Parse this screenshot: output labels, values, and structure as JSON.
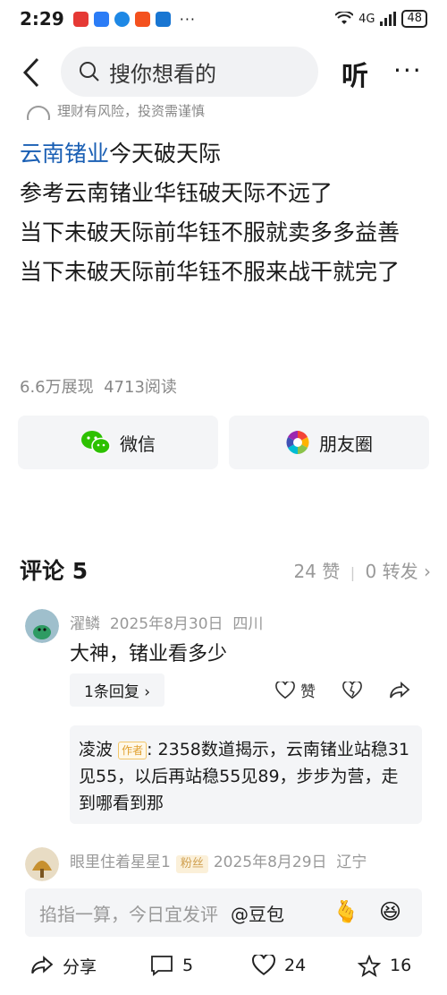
{
  "status": {
    "time": "2:29",
    "dots": "···",
    "network": "4G",
    "battery": "48"
  },
  "header": {
    "search_placeholder": "搜你想看的",
    "listen_label": "听",
    "more_label": "···"
  },
  "risk_notice": "理财有风险，投资需谨慎",
  "article": {
    "link_text": "云南锗业",
    "line1_rest": "今天破天际",
    "line2": "参考云南锗业华钰破天际不远了",
    "line3": "当下未破天际前华钰不服就卖多多益善",
    "line4": "当下未破天际前华钰不服来战干就完了"
  },
  "stats": {
    "views": "6.6万展现",
    "reads": "4713阅读"
  },
  "share": {
    "wechat": "微信",
    "moments": "朋友圈"
  },
  "comments_header": {
    "title": "评论 5",
    "likes": "24 赞",
    "forwards": "0 转发"
  },
  "comment1": {
    "user": "濯鳞",
    "date": "2025年8月30日",
    "location": "四川",
    "text": "大神，锗业看多少",
    "reply_count_label": "1条回复",
    "like_label": "赞"
  },
  "reply": {
    "author": "凌波",
    "author_tag": "作者",
    "text": ": 2358数道揭示，云南锗业站稳31见55，以后再站稳55见89，步步为营，走到哪看到那"
  },
  "comment2": {
    "user": "眼里住着星星1",
    "tag": "粉丝",
    "date": "2025年8月29日",
    "location": "辽宁"
  },
  "input": {
    "placeholder": "掐指一算，今日宜发评",
    "doubao": "@豆包"
  },
  "bottom": {
    "share": "分享",
    "comments": "5",
    "likes": "24",
    "favorites": "16"
  },
  "colors": {
    "link": "#1a5fb4",
    "background": "#ffffff",
    "muted": "#999999"
  }
}
